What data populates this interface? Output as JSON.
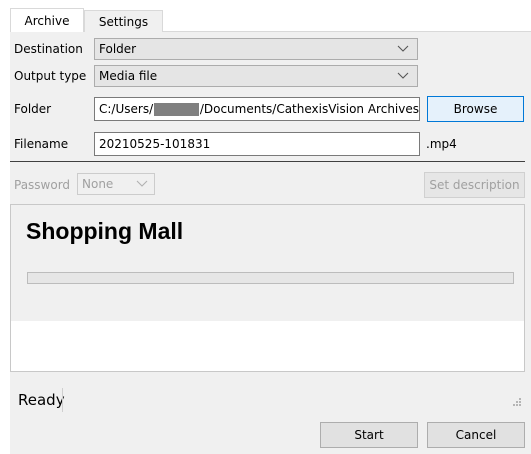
{
  "tabs": [
    {
      "label": "Archive",
      "active": true
    },
    {
      "label": "Settings",
      "active": false
    }
  ],
  "fields": {
    "destination": {
      "label": "Destination",
      "value": "Folder"
    },
    "output_type": {
      "label": "Output type",
      "value": "Media file"
    },
    "folder": {
      "label": "Folder",
      "value_prefix": "C:/Users/",
      "value_suffix": "/Documents/CathexisVision Archives"
    },
    "filename": {
      "label": "Filename",
      "value": "20210525-101831",
      "extension": ".mp4"
    },
    "password": {
      "label": "Password",
      "value": "None"
    }
  },
  "buttons": {
    "browse": "Browse",
    "set_description": "Set description",
    "start": "Start",
    "cancel": "Cancel"
  },
  "status": {
    "site_name": "Shopping Mall",
    "progress_fraction": 0,
    "state_text": "Ready"
  },
  "colors": {
    "primary_button_border": "#0078d7",
    "progress_fill": "#06b025",
    "panel_background": "#f0f0f0"
  }
}
